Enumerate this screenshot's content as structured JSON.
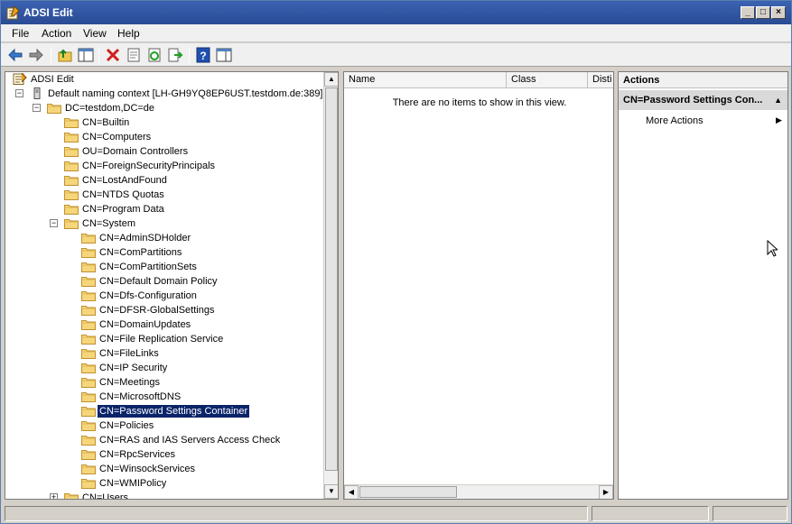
{
  "window": {
    "title": "ADSI Edit"
  },
  "menu": [
    "File",
    "Action",
    "View",
    "Help"
  ],
  "toolbar": {
    "buttons": [
      "back-icon",
      "forward-icon",
      "up-folder-icon",
      "show-hide-tree-icon",
      "delete-icon",
      "properties-icon",
      "refresh-icon",
      "export-list-icon",
      "help-icon",
      "show-hide-action-pane-icon"
    ]
  },
  "tree": {
    "root": "ADSI Edit",
    "context": "Default naming context [LH-GH9YQ8EP6UST.testdom.de:389]",
    "domain": "DC=testdom,DC=de",
    "level1": [
      "CN=Builtin",
      "CN=Computers",
      "OU=Domain Controllers",
      "CN=ForeignSecurityPrincipals",
      "CN=LostAndFound",
      "CN=NTDS Quotas",
      "CN=Program Data"
    ],
    "system": "CN=System",
    "system_children": [
      "CN=AdminSDHolder",
      "CN=ComPartitions",
      "CN=ComPartitionSets",
      "CN=Default Domain Policy",
      "CN=Dfs-Configuration",
      "CN=DFSR-GlobalSettings",
      "CN=DomainUpdates",
      "CN=File Replication Service",
      "CN=FileLinks",
      "CN=IP Security",
      "CN=Meetings",
      "CN=MicrosoftDNS",
      "CN=Password Settings Container",
      "CN=Policies",
      "CN=RAS and IAS Servers Access Check",
      "CN=RpcServices",
      "CN=WinsockServices",
      "CN=WMIPolicy"
    ],
    "selected": "CN=Password Settings Container",
    "users": "CN=Users"
  },
  "list": {
    "columns": [
      "Name",
      "Class",
      "Disti"
    ],
    "empty_message": "There are no items to show in this view."
  },
  "actions": {
    "header": "Actions",
    "section": "CN=Password Settings Con...",
    "items": [
      "More Actions"
    ]
  },
  "colors": {
    "selection": "#0a246a",
    "titlebar": "#2a4b94"
  }
}
